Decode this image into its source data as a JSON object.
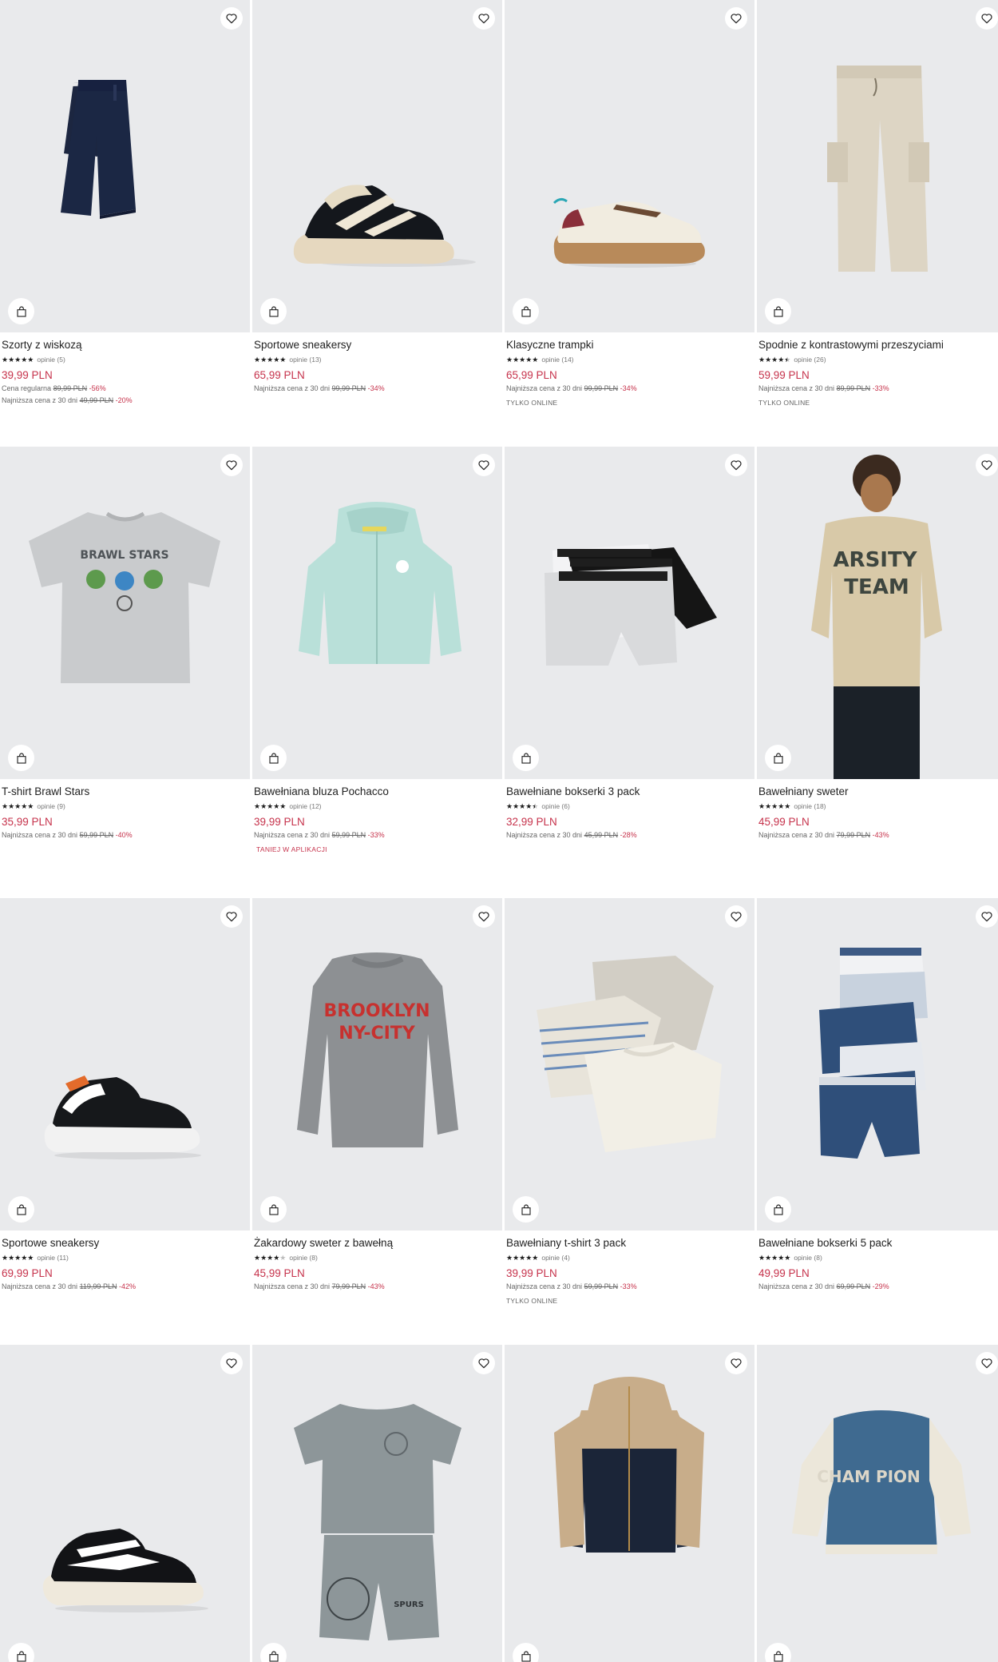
{
  "colors": {
    "accent": "#c6324b",
    "tile_bg": "#e9eaec",
    "text": "#222222",
    "muted": "#666666"
  },
  "icons": {
    "favorite": "heart-icon",
    "cart": "shopping-bag-icon",
    "rating": "star-icon"
  },
  "products": [
    {
      "name": "Szorty z wiskozą",
      "stars": 5,
      "reviews": "opinie (5)",
      "price": "39,99 PLN",
      "lines": [
        {
          "label": "Cena regularna",
          "old": "89,99 PLN",
          "disc": "-56%"
        },
        {
          "label": "Najniższa cena z 30 dni",
          "old": "49,99 PLN",
          "disc": "-20%"
        }
      ],
      "tag": ""
    },
    {
      "name": "Sportowe sneakersy",
      "stars": 5,
      "reviews": "opinie (13)",
      "price": "65,99 PLN",
      "lines": [
        {
          "label": "Najniższa cena z 30 dni",
          "old": "99,99 PLN",
          "disc": "-34%"
        }
      ],
      "tag": ""
    },
    {
      "name": "Klasyczne trampki",
      "stars": 5,
      "reviews": "opinie (14)",
      "price": "65,99 PLN",
      "lines": [
        {
          "label": "Najniższa cena z 30 dni",
          "old": "99,99 PLN",
          "disc": "-34%"
        }
      ],
      "tag": "TYLKO ONLINE"
    },
    {
      "name": "Spodnie z kontrastowymi przeszyciami",
      "stars": 4.5,
      "reviews": "opinie (26)",
      "price": "59,99 PLN",
      "lines": [
        {
          "label": "Najniższa cena z 30 dni",
          "old": "89,99 PLN",
          "disc": "-33%"
        }
      ],
      "tag": "TYLKO ONLINE"
    },
    {
      "name": "T-shirt Brawl Stars",
      "stars": 5,
      "reviews": "opinie (9)",
      "price": "35,99 PLN",
      "lines": [
        {
          "label": "Najniższa cena z 30 dni",
          "old": "59,99 PLN",
          "disc": "-40%"
        }
      ],
      "tag": ""
    },
    {
      "name": "Bawełniana bluza Pochacco",
      "stars": 5,
      "reviews": "opinie (12)",
      "price": "39,99 PLN",
      "lines": [
        {
          "label": "Najniższa cena z 30 dni",
          "old": "59,99 PLN",
          "disc": "-33%"
        }
      ],
      "tag": "",
      "app_tag": "TANIEJ W APLIKACJI"
    },
    {
      "name": "Bawełniane bokserki 3 pack",
      "stars": 4.5,
      "reviews": "opinie (6)",
      "price": "32,99 PLN",
      "lines": [
        {
          "label": "Najniższa cena z 30 dni",
          "old": "45,99 PLN",
          "disc": "-28%"
        }
      ],
      "tag": ""
    },
    {
      "name": "Bawełniany sweter",
      "stars": 5,
      "reviews": "opinie (18)",
      "price": "45,99 PLN",
      "lines": [
        {
          "label": "Najniższa cena z 30 dni",
          "old": "79,99 PLN",
          "disc": "-43%"
        }
      ],
      "tag": ""
    },
    {
      "name": "Sportowe sneakersy",
      "stars": 5,
      "reviews": "opinie (11)",
      "price": "69,99 PLN",
      "lines": [
        {
          "label": "Najniższa cena z 30 dni",
          "old": "119,99 PLN",
          "disc": "-42%"
        }
      ],
      "tag": ""
    },
    {
      "name": "Żakardowy sweter z bawełną",
      "stars": 4,
      "reviews": "opinie (8)",
      "price": "45,99 PLN",
      "lines": [
        {
          "label": "Najniższa cena z 30 dni",
          "old": "79,99 PLN",
          "disc": "-43%"
        }
      ],
      "tag": ""
    },
    {
      "name": "Bawełniany t-shirt 3 pack",
      "stars": 5,
      "reviews": "opinie (4)",
      "price": "39,99 PLN",
      "lines": [
        {
          "label": "Najniższa cena z 30 dni",
          "old": "59,99 PLN",
          "disc": "-33%"
        }
      ],
      "tag": "TYLKO ONLINE"
    },
    {
      "name": "Bawełniane bokserki 5 pack",
      "stars": 5,
      "reviews": "opinie (8)",
      "price": "49,99 PLN",
      "lines": [
        {
          "label": "Najniższa cena z 30 dni",
          "old": "69,99 PLN",
          "disc": "-29%"
        }
      ],
      "tag": ""
    },
    {
      "name": "",
      "stars": 0,
      "reviews": "",
      "price": "",
      "lines": [],
      "tag": ""
    },
    {
      "name": "",
      "stars": 0,
      "reviews": "",
      "price": "",
      "lines": [],
      "tag": ""
    },
    {
      "name": "",
      "stars": 0,
      "reviews": "",
      "price": "",
      "lines": [],
      "tag": ""
    },
    {
      "name": "",
      "stars": 0,
      "reviews": "",
      "price": "",
      "lines": [],
      "tag": ""
    }
  ]
}
